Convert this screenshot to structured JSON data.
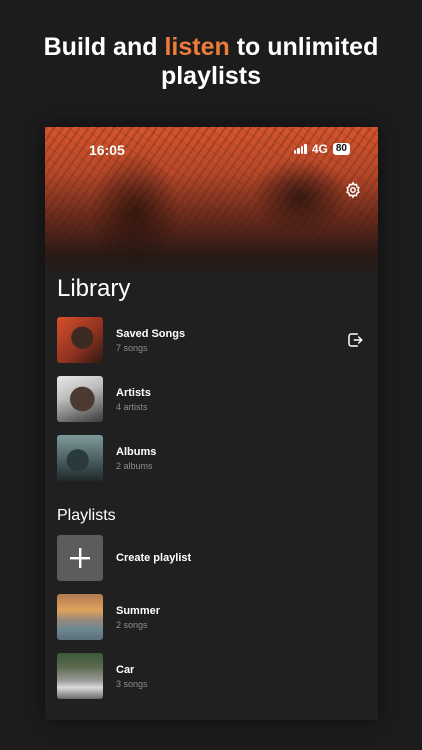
{
  "promo": {
    "headline_part1": "Build and ",
    "headline_accent": "listen",
    "headline_part2": " to unlimited",
    "headline_line2": "playlists",
    "accent_color": "#ee7c3a"
  },
  "status_bar": {
    "time": "16:05",
    "network": "4G",
    "battery": "80"
  },
  "library": {
    "title": "Library",
    "items": [
      {
        "name": "Saved Songs",
        "sub": "7 songs",
        "icon": "saved-songs-cover"
      },
      {
        "name": "Artists",
        "sub": "4 artists",
        "icon": "artists-cover"
      },
      {
        "name": "Albums",
        "sub": "2 albums",
        "icon": "albums-cover"
      }
    ],
    "action_icon": "exit-icon"
  },
  "playlists": {
    "title": "Playlists",
    "create_label": "Create playlist",
    "items": [
      {
        "name": "Summer",
        "sub": "2 songs",
        "icon": "summer-cover"
      },
      {
        "name": "Car",
        "sub": "3 songs",
        "icon": "car-cover"
      }
    ]
  }
}
